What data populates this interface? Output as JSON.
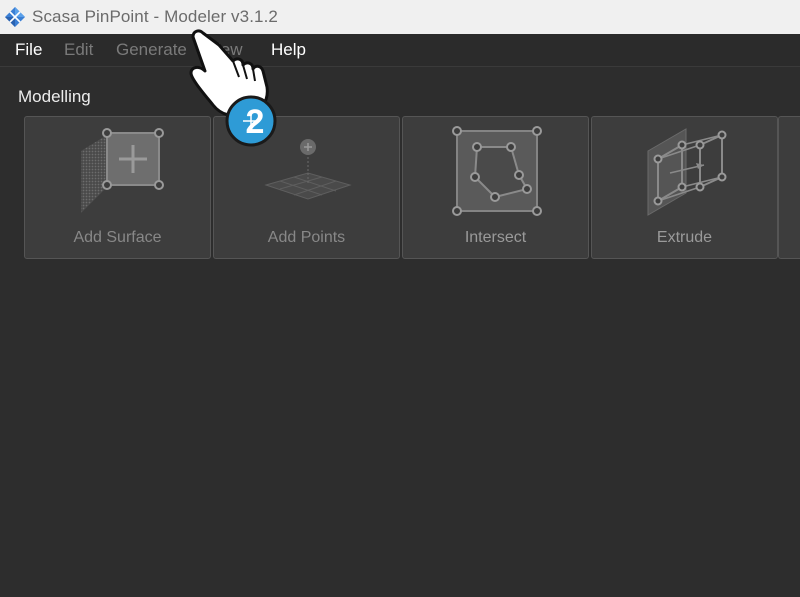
{
  "window": {
    "title": "Scasa PinPoint - Modeler v3.1.2",
    "app_icon": "pinpoint-logo-icon"
  },
  "menu": {
    "items": [
      {
        "label": "File",
        "enabled": true
      },
      {
        "label": "Edit",
        "enabled": false
      },
      {
        "label": "Generate",
        "enabled": false
      },
      {
        "label": "View",
        "enabled": false
      },
      {
        "label": "Help",
        "enabled": true
      }
    ]
  },
  "ribbon": {
    "section_label": "Modelling",
    "tools": [
      {
        "label": "Add Surface",
        "icon": "add-surface-icon",
        "enabled": false
      },
      {
        "label": "Add Points",
        "icon": "add-points-icon",
        "enabled": false
      },
      {
        "label": "Intersect",
        "icon": "intersect-icon",
        "enabled": true
      },
      {
        "label": "Extrude",
        "icon": "extrude-icon",
        "enabled": true
      }
    ]
  },
  "overlay": {
    "step_badge": "2",
    "cursor_icon": "hand-pointer-icon"
  },
  "colors": {
    "titlebar_bg": "#f0f0f0",
    "app_bg": "#2d2d2d",
    "button_bg": "#3d3d3d",
    "badge_blue": "#2e9bd6"
  }
}
